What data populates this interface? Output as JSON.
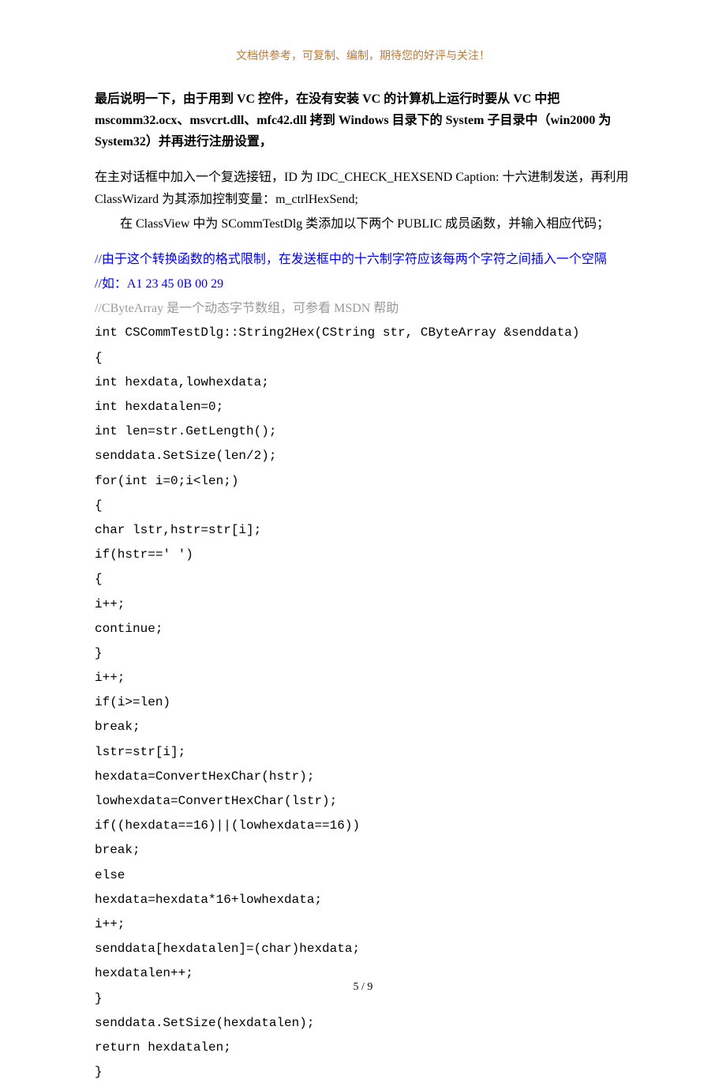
{
  "header_note": "文档供参考，可复制、编制，期待您的好评与关注！",
  "bold_intro": "最后说明一下，由于用到 VC 控件，在没有安装 VC 的计算机上运行时要从 VC 中把 mscomm32.ocx、msvcrt.dll、mfc42.dll 拷到 Windows 目录下的 System 子目录中（win2000 为 System32）并再进行注册设置，",
  "para1": "在主对话框中加入一个复选接钮，ID 为 IDC_CHECK_HEXSEND Caption: 十六进制发送，再利用 ClassWizard 为其添加控制变量：m_ctrlHexSend;",
  "para2": "在 ClassView 中为 SCommTestDlg 类添加以下两个 PUBLIC 成员函数，并输入相应代码；",
  "comment1": "//由于这个转换函数的格式限制，在发送框中的十六制字符应该每两个字符之间插入一个空隔",
  "comment2": "//如：A1 23 45 0B 00 29",
  "comment3": "//CByteArray 是一个动态字节数组，可参看 MSDN 帮助",
  "code": [
    "int CSCommTestDlg::String2Hex(CString str, CByteArray &senddata)",
    "{",
    "int hexdata,lowhexdata;",
    "int hexdatalen=0;",
    "int len=str.GetLength();",
    "senddata.SetSize(len/2);",
    "for(int i=0;i<len;)",
    "{",
    "char lstr,hstr=str[i];",
    "if(hstr==' ')",
    "{",
    "i++;",
    "continue;",
    "}",
    "i++;",
    "if(i>=len)",
    "break;",
    "lstr=str[i];",
    "hexdata=ConvertHexChar(hstr);",
    "lowhexdata=ConvertHexChar(lstr);",
    "if((hexdata==16)||(lowhexdata==16))",
    "break;",
    "else",
    "hexdata=hexdata*16+lowhexdata;",
    "i++;",
    "senddata[hexdatalen]=(char)hexdata;",
    "hexdatalen++;",
    "}",
    "senddata.SetSize(hexdatalen);",
    "return hexdatalen;",
    "}"
  ],
  "page_num": "5 / 9"
}
